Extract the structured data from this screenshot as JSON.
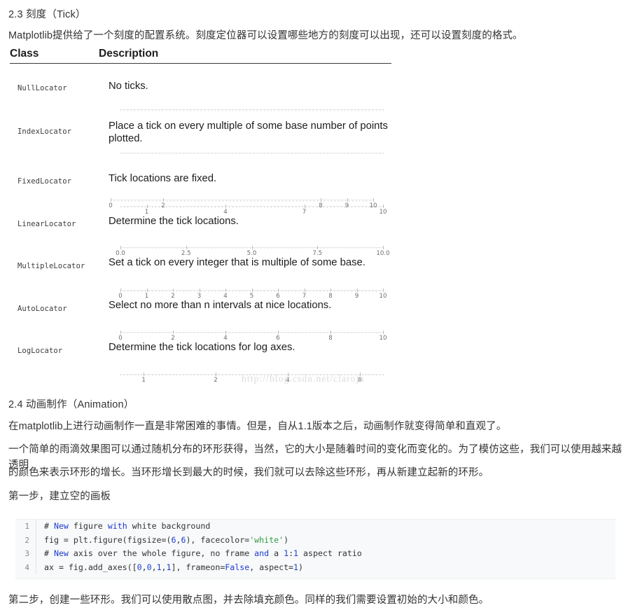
{
  "section_tick": {
    "heading": "2.3 刻度（Tick）",
    "intro": "Matplotlib提供给了一个刻度的配置系统。刻度定位器可以设置哪些地方的刻度可以出现，还可以设置刻度的格式。"
  },
  "locator_table": {
    "headers": {
      "class": "Class",
      "description": "Description"
    },
    "rows": [
      {
        "class": "NullLocator",
        "description": "No ticks."
      },
      {
        "class": "IndexLocator",
        "description": "Place a tick on every multiple of some base number of points plotted."
      },
      {
        "class": "FixedLocator",
        "description": "Tick locations are fixed."
      },
      {
        "class": "LinearLocator",
        "description": "Determine the tick locations."
      },
      {
        "class": "MultipleLocator",
        "description": "Set a tick on every integer that is multiple of some base."
      },
      {
        "class": "AutoLocator",
        "description": "Select no more than n intervals at nice locations."
      },
      {
        "class": "LogLocator",
        "description": "Determine the tick locations for log axes."
      }
    ]
  },
  "chart_data": [
    {
      "type": "axis",
      "name": "NullLocator-axis",
      "xlim": [
        0,
        10
      ],
      "ticks": [],
      "ticklabels": [],
      "minor_ticks": true,
      "grid": false
    },
    {
      "type": "axis",
      "name": "IndexLocator-axis",
      "xlim": [
        0,
        10
      ],
      "ticks": [],
      "ticklabels": [],
      "minor_ticks": true,
      "grid": false
    },
    {
      "type": "axis",
      "name": "FixedLocator-axis",
      "xlim": [
        0,
        10
      ],
      "ticks": [
        1,
        4,
        7,
        10
      ],
      "ticklabels": [
        "1",
        "4",
        "7",
        "10"
      ],
      "minor_ticks": true,
      "grid": false
    },
    {
      "type": "axis",
      "name": "LinearLocator-axis",
      "xlim": [
        0,
        10
      ],
      "ticks": [
        0,
        2,
        8,
        9,
        10
      ],
      "ticklabels": [
        "0",
        "2",
        "8",
        "9",
        "10"
      ],
      "minor_ticks": true,
      "grid": false
    },
    {
      "type": "axis",
      "name": "MultipleLocator-axis",
      "xlim": [
        0,
        10
      ],
      "ticks": [
        0,
        2.5,
        5,
        7.5,
        10
      ],
      "ticklabels": [
        "0.0",
        "2.5",
        "5.0",
        "7.5",
        "10.0"
      ],
      "minor_ticks": true,
      "grid": false
    },
    {
      "type": "axis",
      "name": "AutoLocator-axis",
      "xlim": [
        0,
        10
      ],
      "ticks": [
        0,
        1,
        2,
        3,
        4,
        5,
        6,
        7,
        8,
        9,
        10
      ],
      "ticklabels": [
        "0",
        "1",
        "2",
        "3",
        "4",
        "5",
        "6",
        "7",
        "8",
        "9",
        "10"
      ],
      "minor_ticks": true,
      "grid": false
    },
    {
      "type": "axis",
      "name": "LogLocator-axis",
      "xlim": [
        0,
        10
      ],
      "ticks": [
        0,
        2,
        4,
        6,
        8,
        10
      ],
      "ticklabels": [
        "0",
        "2",
        "4",
        "6",
        "8",
        "10"
      ],
      "minor_ticks": true,
      "grid": false
    },
    {
      "type": "axis",
      "name": "LogLocator-log-axis",
      "scale": "log",
      "xlim": [
        0.8,
        10
      ],
      "ticks": [
        1,
        2,
        4,
        8
      ],
      "ticklabels": [
        "1",
        "2",
        "4",
        "8"
      ],
      "minor_ticks": true,
      "grid": false
    }
  ],
  "watermark": "http://blog.csdn.net/claroja",
  "section_animation": {
    "heading": "2.4 动画制作（Animation）",
    "para1": "在matplotlib上进行动画制作一直是非常困难的事情。但是，自从1.1版本之后，动画制作就变得简单和直观了。",
    "para2": "一个简单的雨滴效果图可以通过随机分布的环形获得，当然，它的大小是随着时间的变化而变化的。为了模仿这些，我们可以使用越来越透明",
    "para3": "的颜色来表示环形的增长。当环形增长到最大的时候，我们就可以去除这些环形，再从新建立起新的环形。",
    "step1": "第一步，建立空的画板",
    "step2": "第二步，创建一些环形。我们可以使用散点图，并去除填充颜色。同样的我们需要设置初始的大小和颜色。"
  },
  "code_block": {
    "language": "python",
    "lines": [
      {
        "number": "1",
        "text": "# New figure with white background"
      },
      {
        "number": "2",
        "text": "fig = plt.figure(figsize=(6,6), facecolor='white')"
      },
      {
        "number": "3",
        "text": "# New axis over the whole figure, no frame and a 1:1 aspect ratio"
      },
      {
        "number": "4",
        "text": "ax = fig.add_axes([0,0,1,1], frameon=False, aspect=1)"
      }
    ]
  },
  "colors": {
    "keyword": "#1f3bd1",
    "string": "#2e9e3e",
    "number": "#1f3bd1",
    "code_background": "#f7f9fa",
    "text": "#333333",
    "watermark": "#dcdcdc"
  }
}
